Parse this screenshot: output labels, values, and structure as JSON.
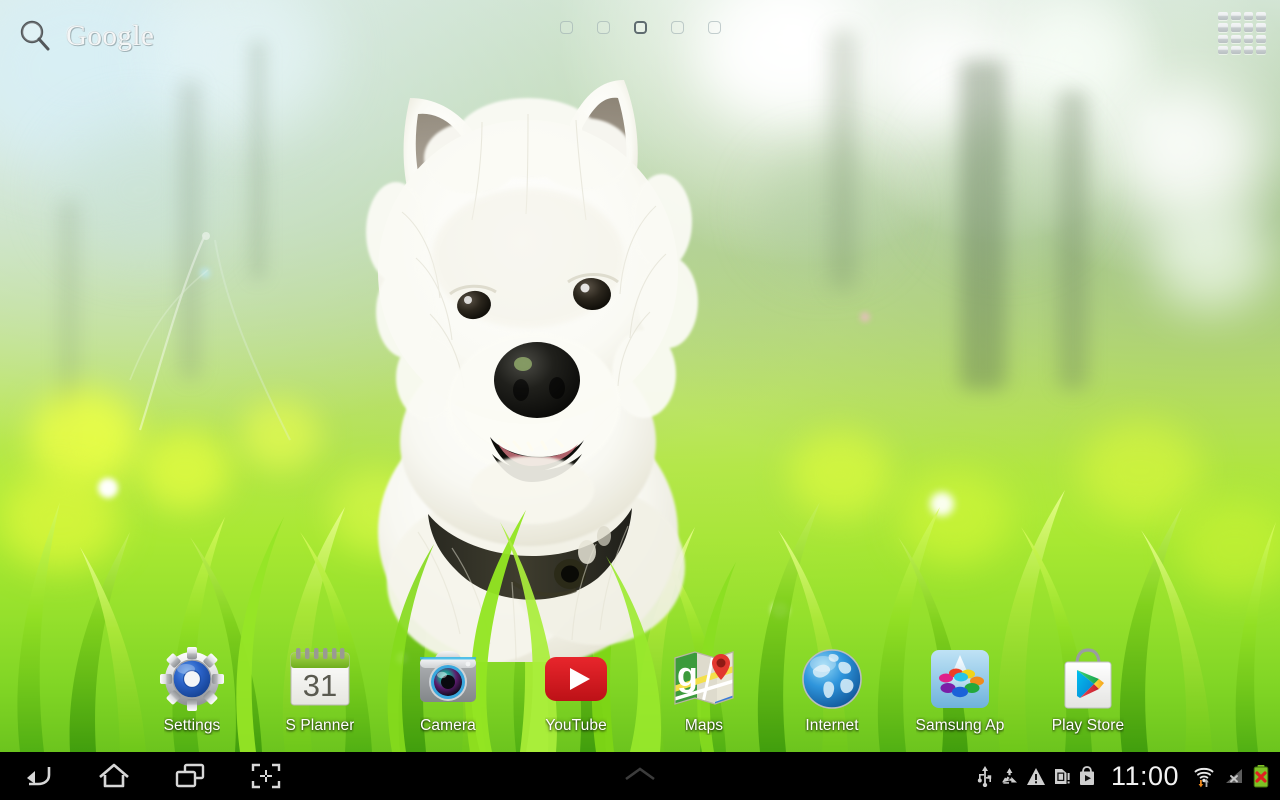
{
  "device": {
    "platform": "android-tablet-home-screen",
    "resolution": "1280x800"
  },
  "wallpaper": {
    "subject": "west-highland-white-terrier-in-grass",
    "description": "White terrier dog sitting in sunlit green grass with yellow flowers",
    "colors": {
      "sky": "#e1f0f5",
      "grass_bright": "#b6ec3f",
      "grass_deep": "#6cc41e",
      "canopy": "#96be78"
    }
  },
  "search_widget": {
    "label": "Google",
    "icon": "search-icon",
    "placeholder": "Google"
  },
  "page_indicator": {
    "total": 5,
    "active_index": 2
  },
  "apps_button": {
    "label": "Apps",
    "icon": "apps-grid-icon",
    "grid": 16
  },
  "dock": {
    "items": [
      {
        "label": "Settings",
        "icon": "settings-gear-icon",
        "color": "#2d5fc0"
      },
      {
        "label": "S Planner",
        "icon": "calendar-icon",
        "color": "#8cc63f",
        "day": "31"
      },
      {
        "label": "Camera",
        "icon": "camera-icon",
        "color": "#8c8c8c"
      },
      {
        "label": "YouTube",
        "icon": "youtube-icon",
        "color": "#cc181e"
      },
      {
        "label": "Maps",
        "icon": "maps-icon",
        "color": "#3a8f3a"
      },
      {
        "label": "Internet",
        "icon": "globe-icon",
        "color": "#1f87d8"
      },
      {
        "label": "Samsung Ap",
        "icon": "samsung-apps-icon",
        "color": "#8ec6ea"
      },
      {
        "label": "Play Store",
        "icon": "play-store-icon",
        "color": "#f5f5f5"
      }
    ]
  },
  "navbar": {
    "buttons": [
      {
        "name": "back",
        "icon": "back-arrow-icon"
      },
      {
        "name": "home",
        "icon": "home-icon"
      },
      {
        "name": "recents",
        "icon": "recent-apps-icon"
      },
      {
        "name": "screenshot",
        "icon": "screen-capture-icon"
      }
    ],
    "handle": {
      "icon": "chevron-up-icon"
    }
  },
  "status_bar": {
    "time": "11:00",
    "icons": [
      {
        "name": "usb-icon",
        "title": "USB connected"
      },
      {
        "name": "recycle-icon",
        "title": "Sync"
      },
      {
        "name": "warning-icon",
        "title": "Warning"
      },
      {
        "name": "sd-card-alert-icon",
        "title": "SD card"
      },
      {
        "name": "play-store-bag-icon",
        "title": "Play Store"
      }
    ],
    "wifi": {
      "icon": "wifi-icon",
      "activity": "up-down-arrows"
    },
    "signal": {
      "icon": "no-signal-icon",
      "state": "no-sim"
    },
    "battery": {
      "icon": "battery-error-icon",
      "state": "error",
      "color": "#7ec225"
    }
  }
}
